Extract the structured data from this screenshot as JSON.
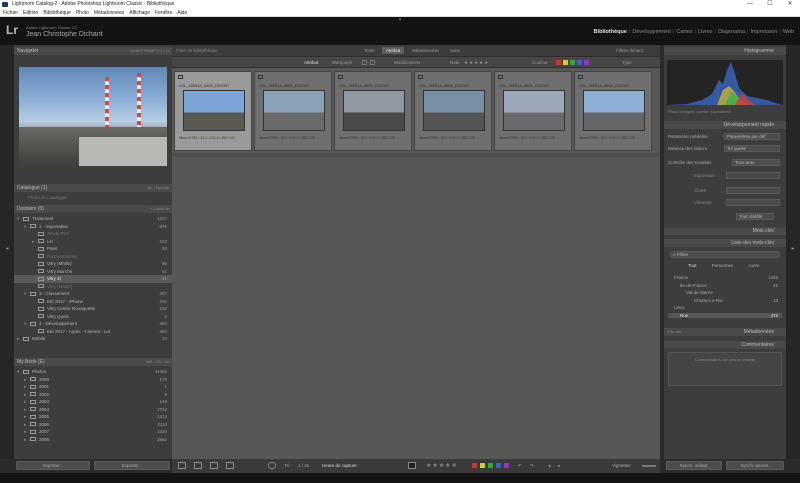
{
  "titlebar": {
    "title": "Lightroom Catalog-2 - Adobe Photoshop Lightroom Classic - Bibliothèque",
    "min": "—",
    "max": "☐",
    "close": "✕"
  },
  "menu": [
    "Fichier",
    "Edition",
    "Bibliothèque",
    "Photo",
    "Métadonnées",
    "Affichage",
    "Fenêtre",
    "Aide"
  ],
  "identity": {
    "logo": "Lr",
    "catalog": "Adobe Lightroom Classic CC",
    "user": "Jean Christophe Dichant"
  },
  "modules": [
    "Bibliothèque",
    "Développement",
    "Cartes",
    "Livres",
    "Diaporama",
    "Impression",
    "Web"
  ],
  "left": {
    "navigator": {
      "title": "Navigator",
      "zoom": "ADAPT  REMP  1:1  1:3"
    },
    "catalogue": {
      "title": "Catalogue (1)",
      "aside": "Ajt. | Spécial",
      "items": [
        {
          "label": "Photo du catalogue",
          "count": ""
        }
      ]
    },
    "dossiers": {
      "title": "Dossiers (0)",
      "aside": "+ | Volume",
      "rows": [
        {
          "t": "▾",
          "label": "Traitement",
          "count": "1257",
          "indent": 3,
          "dim": false
        },
        {
          "t": "▾",
          "label": "1 - Importation",
          "count": "676",
          "indent": 10,
          "dim": false
        },
        {
          "t": "",
          "label": "Art-de-Rue",
          "count": "",
          "indent": 18,
          "dim": true
        },
        {
          "t": "▸",
          "label": "LH",
          "count": "222",
          "indent": 18,
          "dim": false
        },
        {
          "t": "",
          "label": "Paris",
          "count": "93",
          "indent": 18,
          "dim": false
        },
        {
          "t": "",
          "label": "Port Autonome",
          "count": "",
          "indent": 18,
          "dim": true
        },
        {
          "t": "",
          "label": "Vitry (Mhills)",
          "count": "69",
          "indent": 18,
          "dim": false
        },
        {
          "t": "",
          "label": "Vitry Marché",
          "count": "51",
          "indent": 18,
          "dim": false
        },
        {
          "t": "",
          "label": "Vitry 2l",
          "count": "41",
          "indent": 18,
          "dim": false,
          "sel": true
        },
        {
          "t": "",
          "label": "Vitry (Mairie)",
          "count": "",
          "indent": 18,
          "dim": true
        },
        {
          "t": "▾",
          "label": "3 - Classement",
          "count": "497",
          "indent": 10,
          "dim": false
        },
        {
          "t": "",
          "label": "Eté 2017 - iPhone",
          "count": "263",
          "indent": 18,
          "dim": false
        },
        {
          "t": "",
          "label": "Vitry Centre Rouaquette",
          "count": "232",
          "indent": 18,
          "dim": false
        },
        {
          "t": "",
          "label": "Vitry Quais",
          "count": "2",
          "indent": 18,
          "dim": false
        },
        {
          "t": "▾",
          "label": "4 - Développement",
          "count": "380",
          "indent": 10,
          "dim": false
        },
        {
          "t": "",
          "label": "Eté 2017 - Arpès - Cinéma - Lot",
          "count": "380",
          "indent": 18,
          "dim": false
        },
        {
          "t": "▸",
          "label": "Mobile",
          "count": "24",
          "indent": 3,
          "dim": false
        }
      ]
    },
    "mybook": {
      "title": "My Book (E)",
      "aside": "583 / 931 Go",
      "rows": [
        {
          "t": "▾",
          "label": "Photos",
          "count": "44462",
          "indent": 3
        },
        {
          "t": "▸",
          "label": "2000",
          "count": "170",
          "indent": 10
        },
        {
          "t": "▸",
          "label": "2001",
          "count": "1",
          "indent": 10
        },
        {
          "t": "▸",
          "label": "2002",
          "count": "9",
          "indent": 10
        },
        {
          "t": "▸",
          "label": "2003",
          "count": "146",
          "indent": 10
        },
        {
          "t": "▸",
          "label": "2004",
          "count": "1732",
          "indent": 10
        },
        {
          "t": "▸",
          "label": "2005",
          "count": "1213",
          "indent": 10
        },
        {
          "t": "▸",
          "label": "2006",
          "count": "2118",
          "indent": 10
        },
        {
          "t": "▸",
          "label": "2007",
          "count": "1526",
          "indent": 10
        },
        {
          "t": "▸",
          "label": "2008",
          "count": "2862",
          "indent": 10
        }
      ]
    },
    "import_btn": "Importer...",
    "export_btn": "Exporter..."
  },
  "center": {
    "filter_label": "Filtre de bibliothèque :",
    "filter_tabs": [
      "Texte",
      "Attribut",
      "Métadonnées",
      "Sans"
    ],
    "filter_active": "Attribut",
    "filter_state": "Filtres désact.",
    "attr": {
      "label": "Attribut",
      "marq": "Marquage",
      "evol": "Modifications",
      "note": "Note",
      "couleur": "Couleur",
      "type": "Type"
    },
    "thumbs": [
      {
        "name": "V2L_150518_0464_DSCMT",
        "meta": "Nikon D750 • 24.0 / f/11.0 • ISO 100",
        "sel": true,
        "sky": "#7ba5d6",
        "ground": "#5a5a55"
      },
      {
        "name": "V2L_150518_0467_DSCMT",
        "meta": "Nikon D750 • 24.0 / f/11.0 • ISO 100",
        "sel": false,
        "sky": "#8aa1b8",
        "ground": "#6a6a6a"
      },
      {
        "name": "V2L_150518_0454_DSCMT",
        "meta": "Nikon D750 • 24.0 / f/11.0 • ISO 100",
        "sel": false,
        "sky": "#9098a2",
        "ground": "#4a4a4a"
      },
      {
        "name": "V2L_150518_0460_DSCMT",
        "meta": "Nikon D750 • 24.0 / f/11.0 • ISO 100",
        "sel": false,
        "sky": "#7a8ea4",
        "ground": "#555555"
      },
      {
        "name": "V2L_150518_0461_DSCMT",
        "meta": "Nikon D750 • 24.0 / f/11.0 • ISO 100",
        "sel": false,
        "sky": "#9aa8b8",
        "ground": "#6a6a6a"
      },
      {
        "name": "V2L_150518_0463_DSCMT",
        "meta": "Nikon D750 • 24.0 / f/11.0 • ISO 100",
        "sel": false,
        "sky": "#8fb0d4",
        "ground": "#666666"
      }
    ]
  },
  "toolbar": {
    "sort_label": "Tri :",
    "sort_value": "Heure de capture",
    "thumbs_label": "Vignettes",
    "page": "1 / 41"
  },
  "right": {
    "histogram_title": "Histogramme",
    "histogram_caption": "Photo d'origine • perso. équivalente",
    "quickdev": {
      "title": "Développement rapide",
      "preset_label": "Paramètre prédéfini",
      "preset_value": "Paramètres par déf.",
      "wb_label": "Balance des blancs",
      "wb_value": "Tel quelle",
      "tone_label": "Contrôle des tonalités",
      "tone_btn": "Tons auto",
      "exp": "Exposition",
      "clarity": "Clarté",
      "vibrance": "Vibrance",
      "reset": "Tout rétablir"
    },
    "keywords": {
      "title": "Mots-clés"
    },
    "kwlist": {
      "title": "Liste des mots-clés",
      "filter": "Filtrer",
      "tabs": [
        "Tout",
        "Personnes",
        "Autre"
      ],
      "rows": [
        {
          "label": "France",
          "count": "1432",
          "indent": 6
        },
        {
          "label": "Ile-de-France",
          "count": "41",
          "indent": 12
        },
        {
          "label": "Val-de-Marne",
          "count": "",
          "indent": 18
        },
        {
          "label": "Choisy-Le-Roi",
          "count": "13",
          "indent": 26
        },
        {
          "label": "Lieux",
          "count": "",
          "indent": 6
        },
        {
          "label": "Rue",
          "count": "472",
          "indent": 12
        }
      ]
    },
    "metadata": {
      "title": "Métadonnées",
      "preset": "Par déf."
    },
    "comments": {
      "title": "Commentaires",
      "placeholder": "Commentaires non pris en charge"
    },
    "sync_btn": "Synch. métad.",
    "syncset_btn": "Synch. param."
  }
}
